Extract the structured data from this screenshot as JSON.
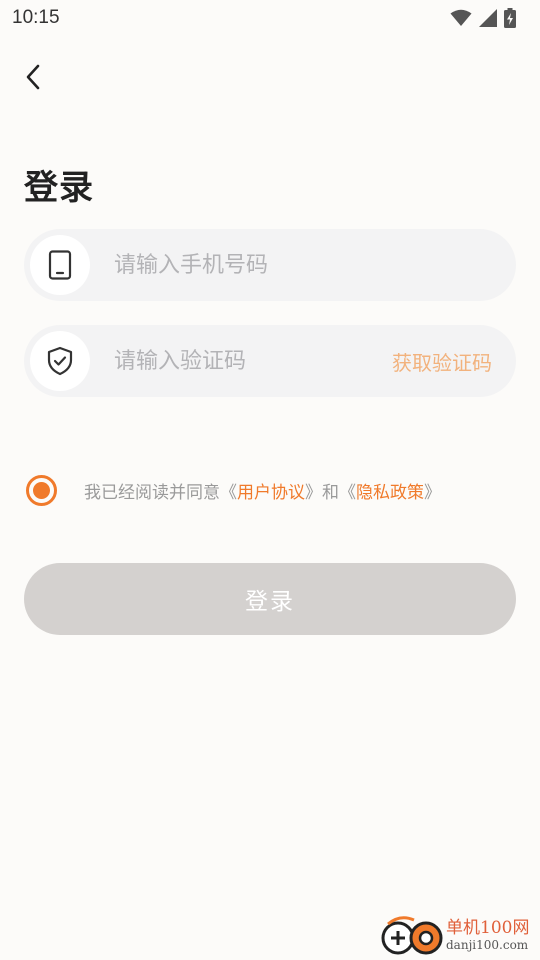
{
  "status_bar": {
    "time": "10:15",
    "icons": [
      "wifi-icon",
      "signal-icon",
      "battery-charging-icon"
    ]
  },
  "header": {
    "back_icon": "chevron-left-icon",
    "title": "登录"
  },
  "form": {
    "phone": {
      "icon": "phone-icon",
      "placeholder": "请输入手机号码",
      "value": ""
    },
    "code": {
      "icon": "shield-check-icon",
      "placeholder": "请输入验证码",
      "value": "",
      "get_code_label": "获取验证码"
    }
  },
  "agreement": {
    "checked": true,
    "prefix": "我已经阅读并同意《",
    "user_agreement": "用户协议",
    "middle": "》和《",
    "privacy_policy": "隐私政策",
    "suffix": "》"
  },
  "login_button": {
    "label": "登录"
  },
  "watermark": {
    "name": "单机100网",
    "domain": "danji100.com"
  },
  "colors": {
    "accent": "#f07a2b",
    "accent_light": "#f2b27d",
    "button_disabled": "#d4d1cf",
    "field_bg": "#f3f3f4",
    "page_bg": "#fcfbf9"
  }
}
